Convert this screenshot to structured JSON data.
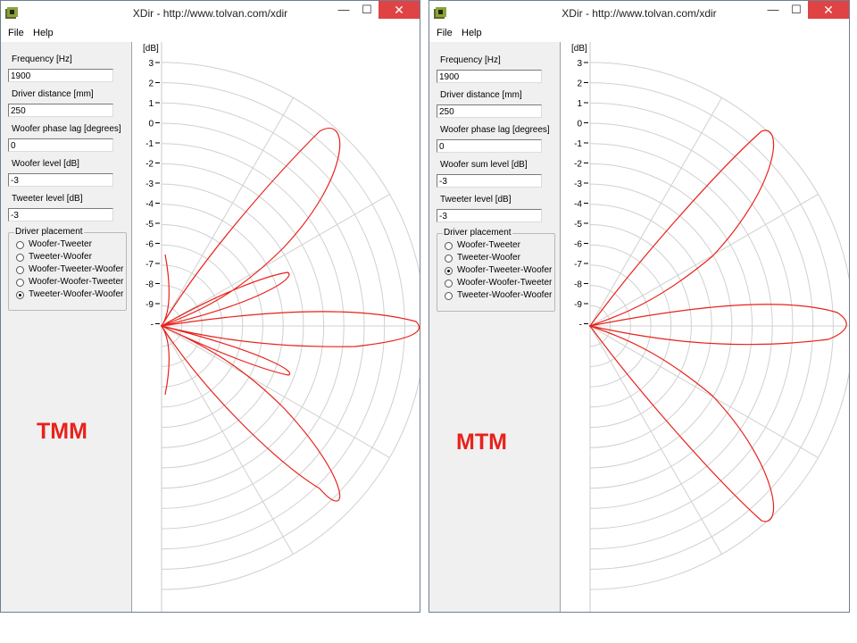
{
  "windows": [
    {
      "title": "XDir - http://www.tolvan.com/xdir",
      "menu": [
        "File",
        "Help"
      ],
      "controls": {
        "minimize": "—",
        "maximize": "☐",
        "close": "✕"
      },
      "fields": [
        {
          "label": "Frequency [Hz]",
          "value": "1900"
        },
        {
          "label": "Driver distance [mm]",
          "value": "250"
        },
        {
          "label": "Woofer phase lag [degrees]",
          "value": "0"
        },
        {
          "label": "Woofer level [dB]",
          "value": "-3"
        },
        {
          "label": "Tweeter level [dB]",
          "value": "-3"
        }
      ],
      "placement": {
        "legend": "Driver placement",
        "options": [
          "Woofer-Tweeter",
          "Tweeter-Woofer",
          "Woofer-Tweeter-Woofer",
          "Woofer-Woofer-Tweeter",
          "Tweeter-Woofer-Woofer"
        ],
        "selected_index": 4
      },
      "overlay_label": "TMM",
      "plot": {
        "unit_label": "[dB]",
        "scale_labels": [
          "3",
          "2",
          "1",
          "0",
          "-1",
          "-2",
          "-3",
          "-4",
          "-5",
          "-6",
          "-7",
          "-8",
          "-9",
          "-"
        ],
        "curve_color": "#e8221b"
      }
    },
    {
      "title": "XDir - http://www.tolvan.com/xdir",
      "menu": [
        "File",
        "Help"
      ],
      "controls": {
        "minimize": "—",
        "maximize": "☐",
        "close": "✕"
      },
      "fields": [
        {
          "label": "Frequency [Hz]",
          "value": "1900"
        },
        {
          "label": "Driver distance [mm]",
          "value": "250"
        },
        {
          "label": "Woofer phase lag [degrees]",
          "value": "0"
        },
        {
          "label": "Woofer sum level [dB]",
          "value": "-3"
        },
        {
          "label": "Tweeter level [dB]",
          "value": "-3"
        }
      ],
      "placement": {
        "legend": "Driver placement",
        "options": [
          "Woofer-Tweeter",
          "Tweeter-Woofer",
          "Woofer-Tweeter-Woofer",
          "Woofer-Woofer-Tweeter",
          "Tweeter-Woofer-Woofer"
        ],
        "selected_index": 2
      },
      "overlay_label": "MTM",
      "plot": {
        "unit_label": "[dB]",
        "scale_labels": [
          "3",
          "2",
          "1",
          "0",
          "-1",
          "-2",
          "-3",
          "-4",
          "-5",
          "-6",
          "-7",
          "-8",
          "-9",
          "-"
        ],
        "curve_color": "#e8221b"
      }
    }
  ]
}
